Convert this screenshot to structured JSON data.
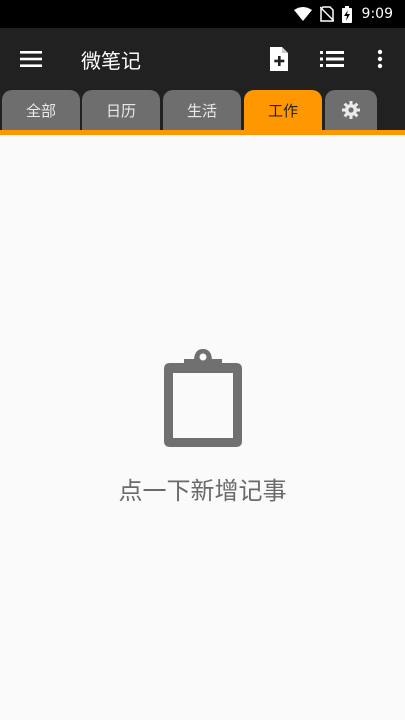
{
  "status_bar": {
    "time": "9:09",
    "icons": [
      "wifi-icon",
      "no-sim-icon",
      "battery-charging-icon"
    ]
  },
  "app_bar": {
    "title": "微笔记",
    "actions": [
      "new-note-icon",
      "list-view-icon",
      "overflow-menu-icon"
    ]
  },
  "tabs": [
    {
      "label": "全部"
    },
    {
      "label": "日历"
    },
    {
      "label": "生活"
    },
    {
      "label": "工作"
    },
    {
      "icon": "gear-icon"
    }
  ],
  "active_tab": "工作",
  "colors": {
    "accent": "#ff9800",
    "toolbar": "#212121",
    "tab_inactive": "#6e6e6e"
  },
  "empty_state": {
    "icon": "clipboard-icon",
    "text": "点一下新增记事"
  }
}
